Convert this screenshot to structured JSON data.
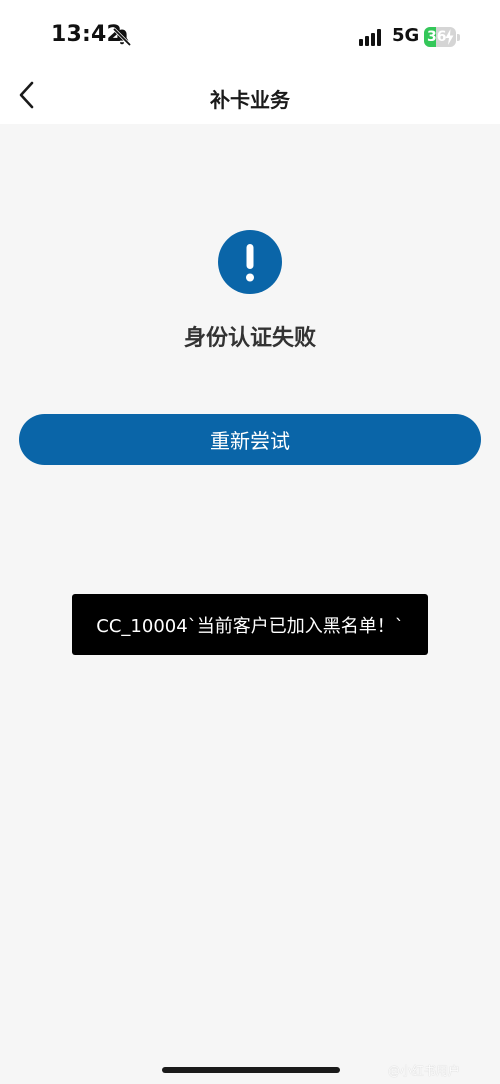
{
  "status_bar": {
    "time": "13:42",
    "network": "5G",
    "battery": "36",
    "battery_level": 0.36
  },
  "header": {
    "title": "补卡业务",
    "back_icon": "chevron-left-icon"
  },
  "alert": {
    "icon": "exclamation-circle-icon",
    "message": "身份认证失败",
    "accent_color": "#0a65a8"
  },
  "actions": {
    "retry_label": "重新尝试"
  },
  "toast": {
    "message": "CC_10004`当前客户已加入黑名单！`"
  },
  "watermark": {
    "text": "@小红书用户"
  }
}
